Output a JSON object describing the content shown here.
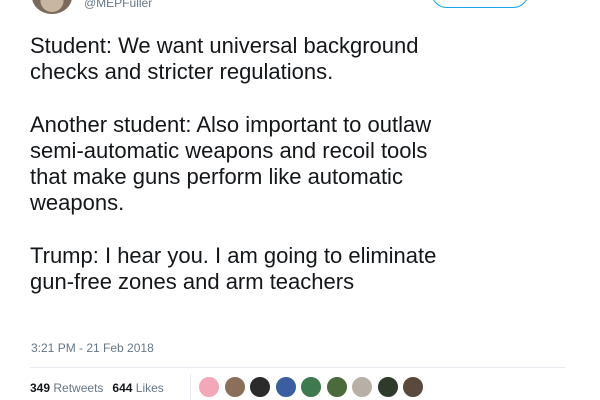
{
  "author": {
    "handle": "@MEPFuller"
  },
  "tweet": {
    "paragraphs": [
      "Student: We want universal background\nchecks and stricter regulations.",
      "Another student: Also important to outlaw\nsemi-automatic weapons and recoil tools\nthat make guns perform like automatic\nweapons.",
      "Trump: I hear you. I am going to eliminate\ngun-free zones and arm teachers"
    ],
    "timestamp": "3:21 PM - 21 Feb 2018"
  },
  "stats": {
    "retweets_count": "349",
    "retweets_label": "Retweets",
    "likes_count": "644",
    "likes_label": "Likes"
  },
  "likers": [
    {
      "name": "liker-1",
      "color": "#f4a7b9"
    },
    {
      "name": "liker-2",
      "color": "#8b6f5a"
    },
    {
      "name": "liker-3",
      "color": "#2b2b2b"
    },
    {
      "name": "liker-4",
      "color": "#3a5fa0"
    },
    {
      "name": "liker-5",
      "color": "#3f7a4e"
    },
    {
      "name": "liker-6",
      "color": "#4c6b3c"
    },
    {
      "name": "liker-7",
      "color": "#b8b0a6"
    },
    {
      "name": "liker-8",
      "color": "#2e3a2a"
    },
    {
      "name": "liker-9",
      "color": "#5a4a3e"
    }
  ]
}
